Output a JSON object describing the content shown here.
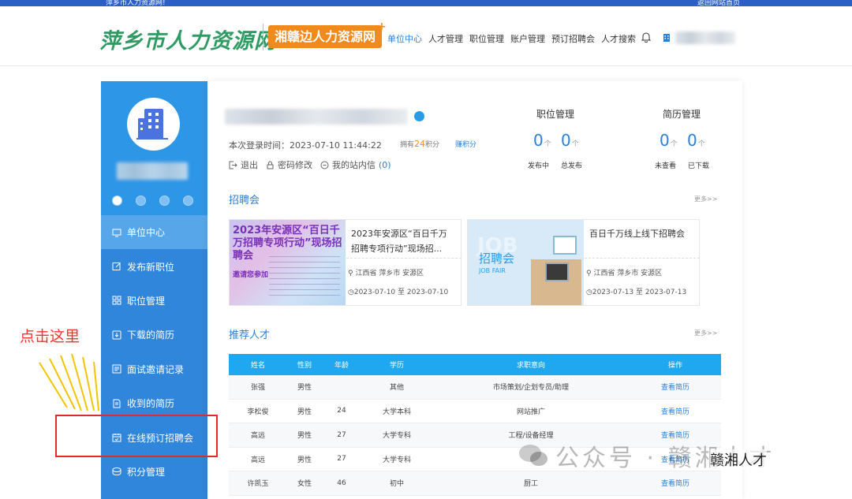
{
  "topbar": {
    "left_text": "萍乡市人力资源网!",
    "right_text": "返回网站首页"
  },
  "header": {
    "logo_main": "萍乡市人力资源网",
    "logo_sub": "湘赣边人力资源网",
    "nav": [
      "单位中心",
      "人才管理",
      "职位管理",
      "账户管理",
      "预订招聘会",
      "人才搜索"
    ],
    "active_nav": "单位中心"
  },
  "sidebar": {
    "menu": [
      {
        "label": "单位中心",
        "icon": "computer-icon",
        "active": true
      },
      {
        "label": "发布新职位",
        "icon": "edit-icon",
        "active": false
      },
      {
        "label": "职位管理",
        "icon": "grid-icon",
        "active": false
      },
      {
        "label": "下载的简历",
        "icon": "download-icon",
        "active": false
      },
      {
        "label": "面试邀请记录",
        "icon": "list-icon",
        "active": false
      },
      {
        "label": "收到的简历",
        "icon": "document-icon",
        "active": false
      },
      {
        "label": "在线预订招聘会",
        "icon": "calendar-icon",
        "active": false
      },
      {
        "label": "积分管理",
        "icon": "coin-icon",
        "active": false
      }
    ]
  },
  "profile": {
    "login_label": "本次登录时间：",
    "login_time": "2023-07-10 11:44:22",
    "points_prefix": "拥有",
    "points_value": "24",
    "points_suffix": "积分",
    "earn_link": "赚积分",
    "actions": [
      "退出",
      "密码修改",
      "我的站内信"
    ],
    "message_count": "(0)"
  },
  "stats": {
    "jobs": {
      "title": "职位管理",
      "items": [
        {
          "value": "0",
          "unit": "个",
          "label": "发布中"
        },
        {
          "value": "0",
          "unit": "个",
          "label": "总发布"
        }
      ]
    },
    "resumes": {
      "title": "简历管理",
      "items": [
        {
          "value": "0",
          "unit": "个",
          "label": "未查看"
        },
        {
          "value": "0",
          "unit": "个",
          "label": "已下载"
        }
      ]
    }
  },
  "fairs": {
    "title": "招聘会",
    "more": "更多>>",
    "items": [
      {
        "title": "2023年安源区“百日千万招聘专项行动”现场招...",
        "location": "江西省 萍乡市 安源区",
        "date": "2023-07-10 至 2023-07-10",
        "image_title": "2023年安源区“百日千万招聘专项行动”现场招聘会",
        "image_sub": "邀请您参加"
      },
      {
        "title": "百日千万线上线下招聘会",
        "location": "江西省 萍乡市 安源区",
        "date": "2023-07-13 至 2023-07-13",
        "image_title": "招聘会",
        "image_sub": "JOB FAIR"
      }
    ]
  },
  "talents": {
    "title": "推荐人才",
    "more": "更多>>",
    "columns": [
      "姓名",
      "性别",
      "年龄",
      "学历",
      "求职意向",
      "操作"
    ],
    "rows": [
      [
        "张强",
        "男性",
        "",
        "其他",
        "市场策划/企划专员/助理",
        "查看简历"
      ],
      [
        "李松俊",
        "男性",
        "24",
        "大学本科",
        "网站推广",
        "查看简历"
      ],
      [
        "高远",
        "男性",
        "27",
        "大学专科",
        "工程/设备经理",
        "查看简历"
      ],
      [
        "高远",
        "男性",
        "27",
        "大学专科",
        "",
        "查看简历"
      ],
      [
        "许凯玉",
        "女性",
        "46",
        "初中",
        "厨工",
        "查看简历"
      ]
    ]
  },
  "annotation": {
    "text": "点击这里"
  },
  "watermark": {
    "text": "公众号 · 赣湘人才",
    "badge": "赣湘人才"
  },
  "colors": {
    "primary": "#2b7fd9",
    "sidebar": "#2f86db",
    "brand_green": "#2f9a63",
    "brand_orange": "#f08a1c",
    "table_head": "#1fa8f0",
    "annotation": "#e32a2a"
  }
}
